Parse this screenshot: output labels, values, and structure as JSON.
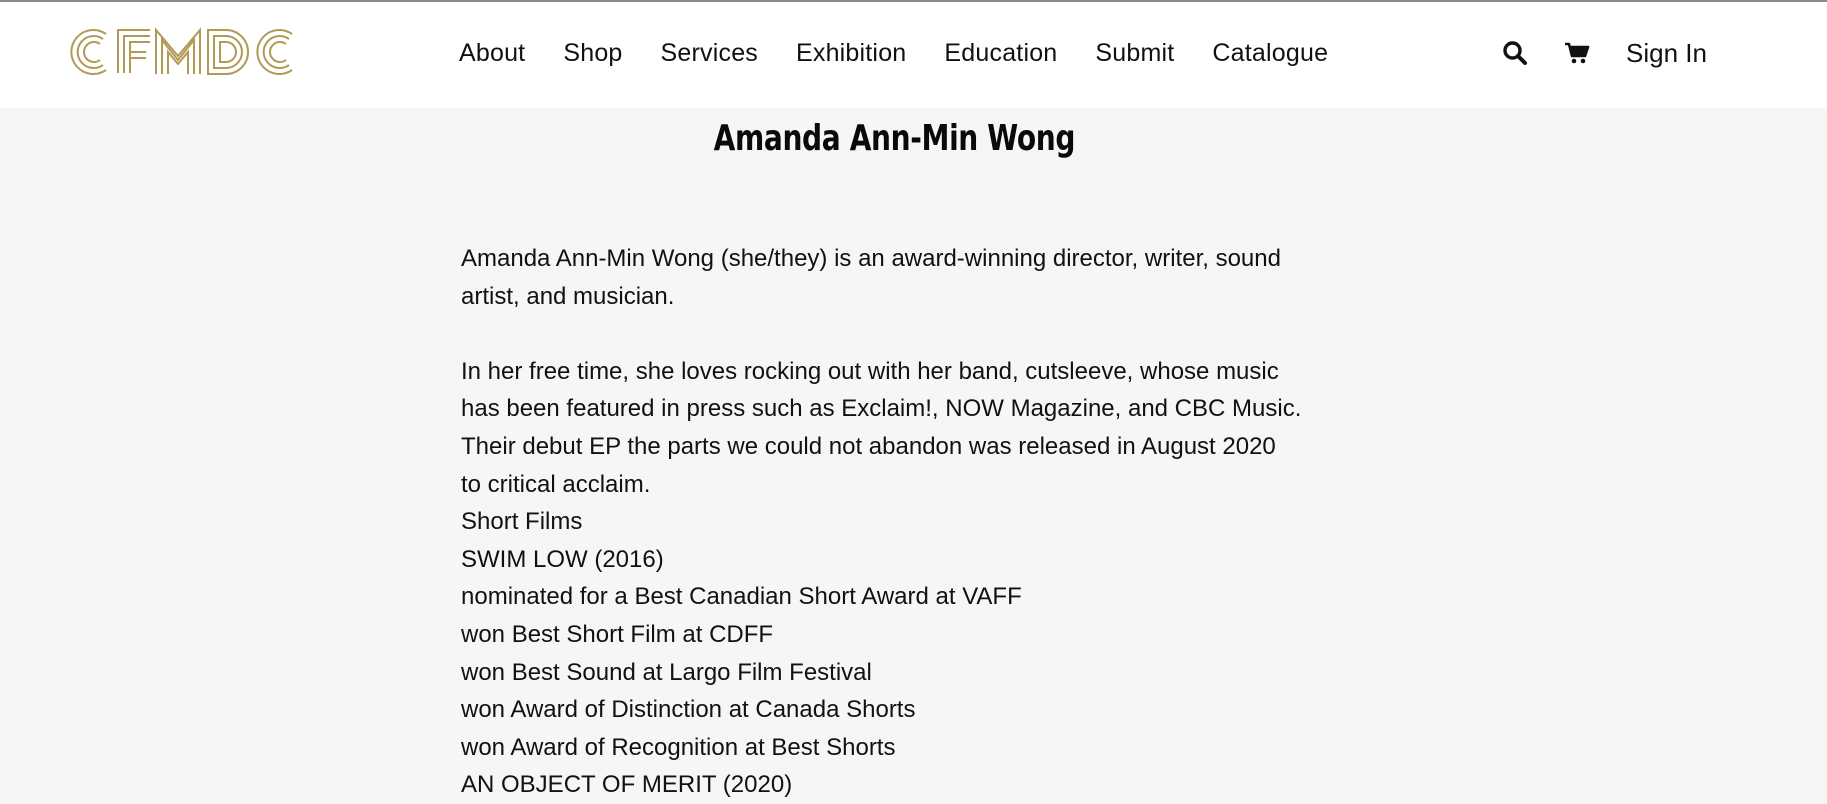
{
  "header": {
    "logo_text": "CFMDC",
    "nav": [
      "About",
      "Shop",
      "Services",
      "Exhibition",
      "Education",
      "Submit",
      "Catalogue"
    ],
    "search_icon": "search-icon",
    "cart_icon": "cart-icon",
    "sign_in_label": "Sign In"
  },
  "colors": {
    "logo_gold": "#b19a55",
    "page_bg": "#f7f6f4",
    "header_bg": "#ffffff"
  },
  "main": {
    "title": "Amanda Ann-Min Wong",
    "bio_para1_lines": [
      "Amanda Ann-Min Wong (she/they) is an award-winning director, writer, sound",
      "artist, and musician."
    ],
    "bio_para2_lines": [
      "In her free time, she loves rocking out with her band, cutsleeve, whose music",
      "has been featured in press such as Exclaim!, NOW Magazine, and CBC Music.",
      "Their debut EP the parts we could not abandon was released in August 2020",
      "to critical acclaim."
    ],
    "list_lines": [
      "Short Films",
      "SWIM LOW (2016)",
      "nominated for a Best Canadian Short Award at VAFF",
      "won Best Short Film at CDFF",
      "won Best Sound at Largo Film Festival",
      "won Award of Distinction at Canada Shorts",
      "won Award of Recognition at Best Shorts",
      "AN OBJECT OF MERIT (2020)"
    ]
  }
}
